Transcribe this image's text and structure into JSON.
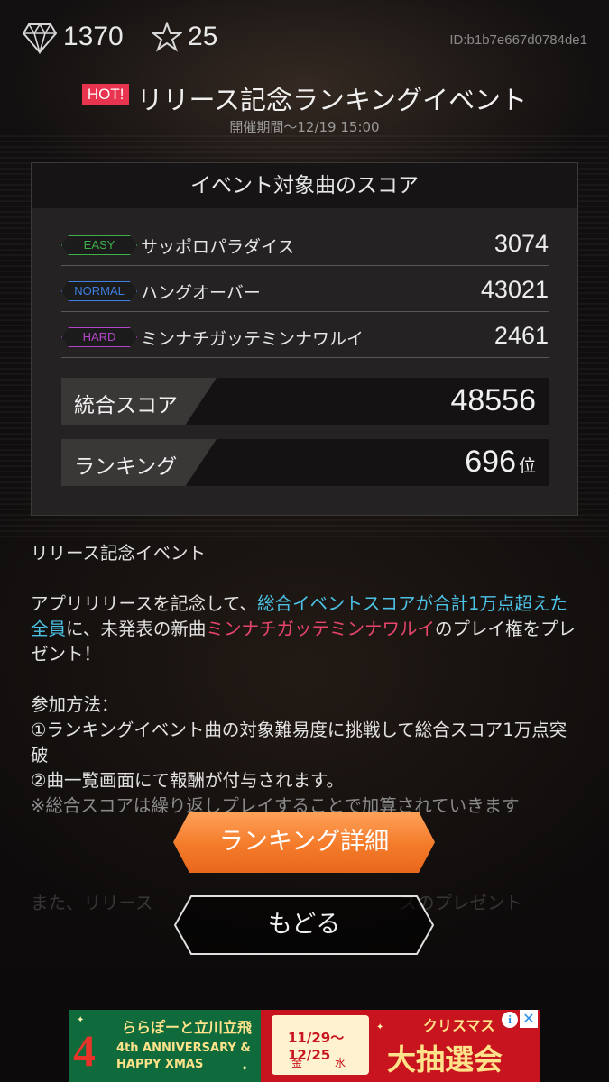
{
  "top_bar": {
    "gem_icon": "diamond-icon",
    "gem_count": "1370",
    "star_icon": "star-icon",
    "star_count": "25",
    "user_id": "ID:b1b7e667d0784de1"
  },
  "event": {
    "badge": "HOT!",
    "title": "リリース記念ランキングイベント",
    "period": "開催期間～12/19 15:00"
  },
  "score_panel": {
    "title": "イベント対象曲のスコア",
    "songs": [
      {
        "difficulty": "EASY",
        "name": "サッポロパラダイス",
        "score": "3074",
        "color": "#3db04a"
      },
      {
        "difficulty": "NORMAL",
        "name": "ハングオーバー",
        "score": "43021",
        "color": "#3e7fe0"
      },
      {
        "difficulty": "HARD",
        "name": "ミンナチガッテミンナワルイ",
        "score": "2461",
        "color": "#b346c9"
      }
    ],
    "total_label": "統合スコア",
    "total_value": "48556",
    "ranking_label": "ランキング",
    "ranking_value": "696",
    "ranking_unit": "位"
  },
  "description": {
    "heading": "リリース記念イベント",
    "p1_a": "アプリリリースを記念して、",
    "p1_b": "総合イベントスコアが合計1万点超えた全員",
    "p1_c": "に、未発表の新曲",
    "p1_d": "ミンナチガッテミンナワルイ",
    "p1_e": "のプレイ権をプレゼント！",
    "how_title": "参加方法：",
    "step1": "①ランキングイベント曲の対象難易度に挑戦して総合スコア1万点突破",
    "step2": "②曲一覧画面にて報酬が付与されます。",
    "note": "※総合スコアは繰り返しプレイすることで加算されていきます",
    "faded_line": "また、リリース　　　　　　　　　　　　　　スのプレゼント"
  },
  "buttons": {
    "ranking_detail": "ランキング詳細",
    "back": "もどる"
  },
  "ad": {
    "brand": "ららぽーと立川立飛",
    "anniversary": "4th ANNIVERSARY &",
    "xmas": "HAPPY XMAS",
    "four": "4",
    "dates": "11/29～12/25",
    "days": "金　　　水",
    "xmas_label": "クリスマス",
    "draw": "大抽選会",
    "info": "i",
    "close": "✕",
    "colors": {
      "left": "#0f6b3c",
      "right": "#c8141e",
      "text": "#ffe38a"
    }
  },
  "colors": {
    "accent_hot": "#e9344f",
    "highlight_cyan": "#4cc2e6",
    "highlight_pink": "#e8456b",
    "button_orange": "#f47b2a"
  }
}
